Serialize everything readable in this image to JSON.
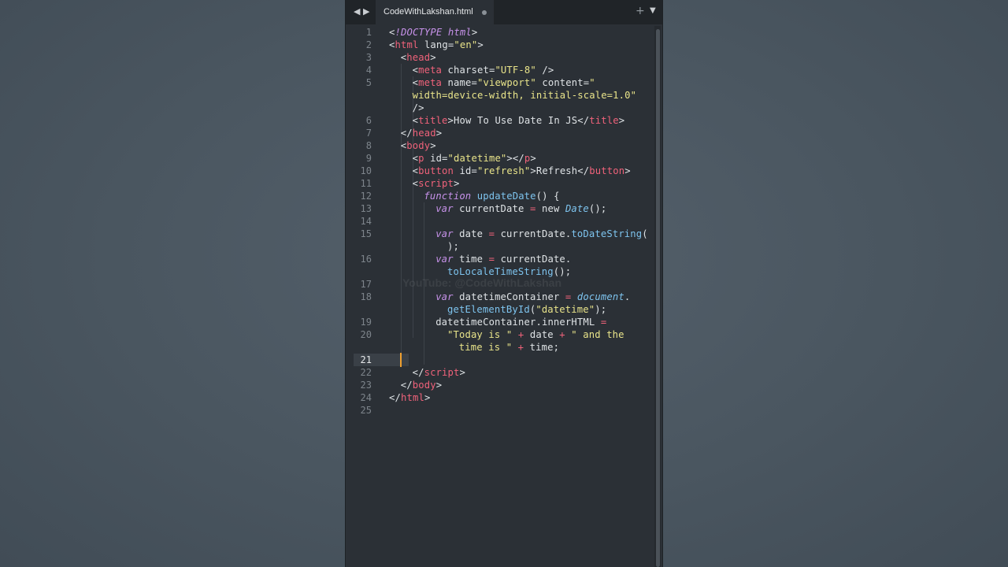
{
  "tab": {
    "filename": "CodeWithLakshan.html"
  },
  "watermark": "YouTube: @CodeWithLakshan",
  "active_line": "21",
  "lines": [
    {
      "n": "1",
      "tokens": [
        [
          "punct",
          "<"
        ],
        [
          "kw",
          "!DOCTYPE "
        ],
        [
          "kw",
          "html"
        ],
        [
          "punct",
          ">"
        ]
      ]
    },
    {
      "n": "2",
      "tokens": [
        [
          "punct",
          "<"
        ],
        [
          "tag",
          "html"
        ],
        [
          "attr",
          " lang="
        ],
        [
          "str",
          "\"en\""
        ],
        [
          "punct",
          ">"
        ]
      ]
    },
    {
      "n": "3",
      "indent": 1,
      "tokens": [
        [
          "punct",
          "<"
        ],
        [
          "tag",
          "head"
        ],
        [
          "punct",
          ">"
        ]
      ]
    },
    {
      "n": "4",
      "indent": 2,
      "tokens": [
        [
          "punct",
          "<"
        ],
        [
          "tag",
          "meta"
        ],
        [
          "attr",
          " charset="
        ],
        [
          "str",
          "\"UTF-8\""
        ],
        [
          "punct",
          " />"
        ]
      ]
    },
    {
      "n": "5",
      "indent": 2,
      "tokens": [
        [
          "punct",
          "<"
        ],
        [
          "tag",
          "meta"
        ],
        [
          "attr",
          " name="
        ],
        [
          "str",
          "\"viewport\""
        ],
        [
          "attr",
          " content="
        ],
        [
          "str",
          "\""
        ]
      ]
    },
    {
      "n": "",
      "indent": 2,
      "tokens": [
        [
          "str",
          "width=device-width, initial-scale=1.0\""
        ]
      ]
    },
    {
      "n": "",
      "indent": 2,
      "tokens": [
        [
          "punct",
          "/>"
        ]
      ]
    },
    {
      "n": "6",
      "indent": 2,
      "tokens": [
        [
          "punct",
          "<"
        ],
        [
          "tag",
          "title"
        ],
        [
          "punct",
          ">"
        ],
        [
          "plain",
          "How To Use Date In JS"
        ],
        [
          "punct",
          "</"
        ],
        [
          "tag",
          "title"
        ],
        [
          "punct",
          ">"
        ]
      ]
    },
    {
      "n": "7",
      "indent": 1,
      "tokens": [
        [
          "punct",
          "</"
        ],
        [
          "tag",
          "head"
        ],
        [
          "punct",
          ">"
        ]
      ]
    },
    {
      "n": "8",
      "indent": 1,
      "tokens": [
        [
          "punct",
          "<"
        ],
        [
          "tag",
          "body"
        ],
        [
          "punct",
          ">"
        ]
      ]
    },
    {
      "n": "9",
      "indent": 2,
      "tokens": [
        [
          "punct",
          "<"
        ],
        [
          "tag",
          "p"
        ],
        [
          "attr",
          " id="
        ],
        [
          "str",
          "\"datetime\""
        ],
        [
          "punct",
          "></"
        ],
        [
          "tag",
          "p"
        ],
        [
          "punct",
          ">"
        ]
      ]
    },
    {
      "n": "10",
      "indent": 2,
      "tokens": [
        [
          "punct",
          "<"
        ],
        [
          "tag",
          "button"
        ],
        [
          "attr",
          " id="
        ],
        [
          "str",
          "\"refresh\""
        ],
        [
          "punct",
          ">"
        ],
        [
          "plain",
          "Refresh"
        ],
        [
          "punct",
          "</"
        ],
        [
          "tag",
          "button"
        ],
        [
          "punct",
          ">"
        ]
      ]
    },
    {
      "n": "11",
      "indent": 2,
      "tokens": [
        [
          "punct",
          "<"
        ],
        [
          "tag",
          "script"
        ],
        [
          "punct",
          ">"
        ]
      ]
    },
    {
      "n": "12",
      "indent": 3,
      "tokens": [
        [
          "kw",
          "function "
        ],
        [
          "fn",
          "updateDate"
        ],
        [
          "plain",
          "() {"
        ]
      ]
    },
    {
      "n": "13",
      "indent": 4,
      "tokens": [
        [
          "kw",
          "var "
        ],
        [
          "plain",
          "currentDate "
        ],
        [
          "op",
          "= "
        ],
        [
          "plain",
          "new "
        ],
        [
          "type",
          "Date"
        ],
        [
          "plain",
          "();"
        ]
      ]
    },
    {
      "n": "14",
      "indent": 0,
      "tokens": []
    },
    {
      "n": "15",
      "indent": 4,
      "tokens": [
        [
          "kw",
          "var "
        ],
        [
          "plain",
          "date "
        ],
        [
          "op",
          "= "
        ],
        [
          "plain",
          "currentDate."
        ],
        [
          "fn",
          "toDateString"
        ],
        [
          "plain",
          "("
        ]
      ]
    },
    {
      "n": "",
      "indent": 5,
      "tokens": [
        [
          "plain",
          ");"
        ]
      ]
    },
    {
      "n": "16",
      "indent": 4,
      "tokens": [
        [
          "kw",
          "var "
        ],
        [
          "plain",
          "time "
        ],
        [
          "op",
          "= "
        ],
        [
          "plain",
          "currentDate."
        ]
      ]
    },
    {
      "n": "",
      "indent": 5,
      "tokens": [
        [
          "fn",
          "toLocaleTimeString"
        ],
        [
          "plain",
          "();"
        ]
      ]
    },
    {
      "n": "17",
      "indent": 0,
      "tokens": []
    },
    {
      "n": "18",
      "indent": 4,
      "tokens": [
        [
          "kw",
          "var "
        ],
        [
          "plain",
          "datetimeContainer "
        ],
        [
          "op",
          "= "
        ],
        [
          "type",
          "document"
        ],
        [
          "plain",
          "."
        ]
      ]
    },
    {
      "n": "",
      "indent": 5,
      "tokens": [
        [
          "fn",
          "getElementById"
        ],
        [
          "plain",
          "("
        ],
        [
          "str",
          "\"datetime\""
        ],
        [
          "plain",
          ");"
        ]
      ]
    },
    {
      "n": "19",
      "indent": 4,
      "tokens": [
        [
          "plain",
          "datetimeContainer.innerHTML "
        ],
        [
          "op",
          "="
        ]
      ]
    },
    {
      "n": "20",
      "indent": 5,
      "tokens": [
        [
          "str",
          "\"Today is \""
        ],
        [
          "op",
          " + "
        ],
        [
          "plain",
          "date "
        ],
        [
          "op",
          "+ "
        ],
        [
          "str",
          "\" and the"
        ]
      ]
    },
    {
      "n": "",
      "indent": 6,
      "tokens": [
        [
          "str",
          "time is \""
        ],
        [
          "op",
          " + "
        ],
        [
          "plain",
          "time;"
        ]
      ]
    },
    {
      "n": "21",
      "indent": 0,
      "tokens": []
    },
    {
      "n": "22",
      "indent": 2,
      "tokens": [
        [
          "punct",
          "</"
        ],
        [
          "tag",
          "script"
        ],
        [
          "punct",
          ">"
        ]
      ]
    },
    {
      "n": "23",
      "indent": 1,
      "tokens": [
        [
          "punct",
          "</"
        ],
        [
          "tag",
          "body"
        ],
        [
          "punct",
          ">"
        ]
      ]
    },
    {
      "n": "24",
      "indent": 0,
      "tokens": [
        [
          "punct",
          "</"
        ],
        [
          "tag",
          "html"
        ],
        [
          "punct",
          ">"
        ]
      ]
    },
    {
      "n": "25",
      "indent": 0,
      "tokens": []
    }
  ]
}
